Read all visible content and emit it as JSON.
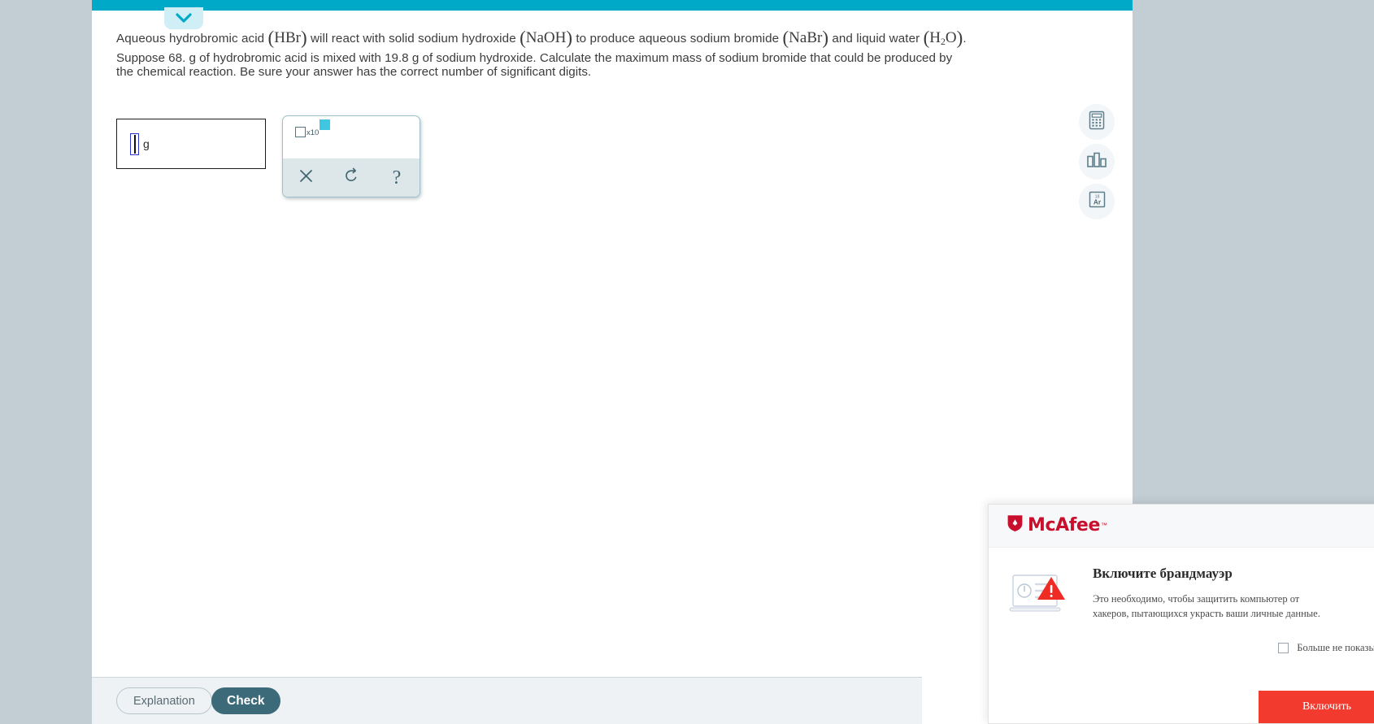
{
  "header": {
    "collapse_icon": "chevron-down-icon",
    "accent_teal": "#00a9c7",
    "tab_bg": "#cfeef6"
  },
  "problem": {
    "reaction_prefix": "Aqueous hydrobromic acid ",
    "reactant_1": "HBr",
    "reaction_mid_1": " will react with solid sodium hydroxide ",
    "reactant_2": "NaOH",
    "reaction_mid_2": " to produce aqueous sodium bromide ",
    "product_1": "NaBr",
    "reaction_mid_3": " and liquid water ",
    "product_2_a": "H",
    "product_2_sub": "2",
    "product_2_b": "O",
    "reaction_end": ".",
    "question": "Suppose 68. g of hydrobromic acid is mixed with 19.8 g of sodium hydroxide. Calculate the maximum mass of sodium bromide that could be produced by the chemical reaction. Be sure your answer has the correct number of significant digits."
  },
  "answer": {
    "value": "",
    "unit": "g",
    "caret_color": "#2b35c8"
  },
  "sci_keypad": {
    "mantissa_placeholder": "",
    "times_ten_label": "x10",
    "exponent_placeholder": "",
    "exponent_highlight_color": "#3fc6e0",
    "buttons": [
      {
        "name": "clear-button",
        "icon": "x-close-icon",
        "label": "×"
      },
      {
        "name": "undo-button",
        "icon": "undo-arrow-icon",
        "label": "↺"
      },
      {
        "name": "help-button",
        "icon": "question-mark-icon",
        "label": "?"
      }
    ]
  },
  "tool_rail": {
    "items": [
      {
        "name": "calculator-tool",
        "icon": "calculator-icon",
        "title": "Calculator"
      },
      {
        "name": "chart-tool",
        "icon": "bar-chart-icon",
        "title": "Data chart"
      },
      {
        "name": "periodic-table-tool",
        "icon": "periodic-element-icon",
        "title": "Periodic table",
        "element_symbol": "Ar",
        "element_number": "18"
      }
    ]
  },
  "footer": {
    "explanation_label": "Explanation",
    "check_label": "Check",
    "check_bg": "#3c6a78"
  },
  "mcafee": {
    "brand": "McAfee",
    "trademark": "™",
    "brand_color": "#c8102e",
    "close_icon": "close-icon",
    "warning_icon": "warning-triangle-icon",
    "title": "Включите брандмауэр",
    "description": "Это необходимо, чтобы защитить компьютер от хакеров, пытающихся украсть ваши личные данные.",
    "dont_show_label": "Больше не показывать",
    "enable_label": "Включить",
    "enable_bg": "#f33a2e"
  }
}
